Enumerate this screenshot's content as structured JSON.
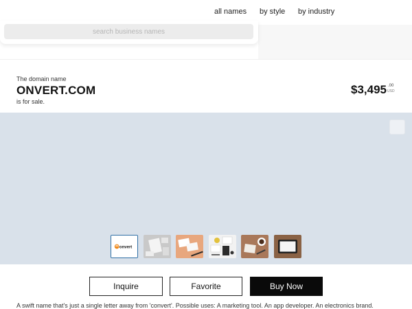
{
  "nav": {
    "items": [
      "all names",
      "by style",
      "by industry"
    ]
  },
  "search": {
    "placeholder": "search business names"
  },
  "listing": {
    "kicker": "The domain name",
    "domain": "ONVERT.COM",
    "for_sale": "is for sale.",
    "price": "$3,495",
    "price_cents": ".00",
    "currency": "USD"
  },
  "thumbnails": {
    "logo_text": "onvert",
    "items": [
      "logo",
      "desk-mockup",
      "business-cards-pen",
      "stationery-flatlay",
      "coffee-desk",
      "tablet-mockup"
    ],
    "selected_index": 0
  },
  "actions": {
    "inquire": "Inquire",
    "favorite": "Favorite",
    "buy_now": "Buy Now"
  },
  "description": "A swift name that's just a single letter away from 'convert'. Possible uses: A marketing tool. An app developer. An electronics brand.",
  "colors": {
    "hero_bg": "#d9e1ea",
    "accent_orange": "#f08a1c",
    "selected_border": "#2f6fa5",
    "buy_button": "#0a0a0a"
  }
}
